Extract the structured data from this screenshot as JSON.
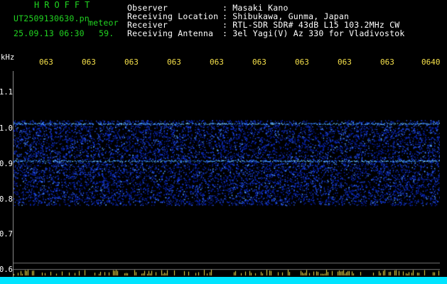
{
  "header": {
    "logo": "HROFFT",
    "filename": "UT2509130630.pn",
    "detect_label": "meteor",
    "datetime": "25.09.13 06:30",
    "count": "59.",
    "info": [
      {
        "label": "Observer",
        "value": ": Masaki Kano"
      },
      {
        "label": "Receiving Location",
        "value": ": Shibukawa, Gunma, Japan"
      },
      {
        "label": "Receiver",
        "value": ": RTL-SDR SDR# 43dB L15 103.2MHz CW"
      },
      {
        "label": "Receiving Antenna",
        "value": ": 3el Yagi(V) Az 330 for Vladivostok"
      }
    ]
  },
  "axes": {
    "y_unit": "kHz",
    "y_ticks": [
      "1.1",
      "1.0",
      "0.9",
      "0.8",
      "0.7",
      "0.6"
    ],
    "y_tick_values": [
      1.1,
      1.0,
      0.9,
      0.8,
      0.7,
      0.6
    ],
    "x_ticks": [
      "063",
      "063",
      "063",
      "063",
      "063",
      "063",
      "063",
      "063",
      "063",
      "0640"
    ]
  },
  "spectrogram": {
    "signal_band_khz": [
      0.78,
      1.02
    ],
    "carrier_lines_khz": [
      1.01,
      0.905
    ],
    "colors": {
      "noise": "#0a2dff",
      "line": "#6fd0ff",
      "bar": "#00e4ff",
      "bar_peak": "#f5e04a"
    }
  }
}
